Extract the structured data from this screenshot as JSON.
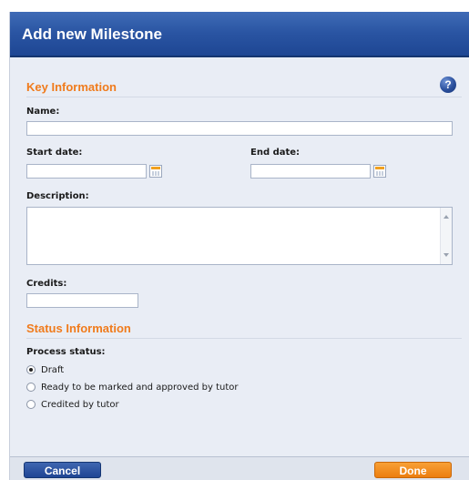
{
  "dialog": {
    "title": "Add new Milestone"
  },
  "key_information": {
    "heading": "Key Information",
    "help_icon": "?",
    "name_label": "Name:",
    "name_value": "",
    "start_date_label": "Start date:",
    "start_date_value": "",
    "end_date_label": "End date:",
    "end_date_value": "",
    "description_label": "Description:",
    "description_value": "",
    "credits_label": "Credits:",
    "credits_value": ""
  },
  "status_information": {
    "heading": "Status Information",
    "process_status_label": "Process status:",
    "options": [
      {
        "label": "Draft",
        "checked": true
      },
      {
        "label": "Ready to be marked and approved by tutor",
        "checked": false
      },
      {
        "label": "Credited by tutor",
        "checked": false
      }
    ]
  },
  "footer": {
    "cancel_label": "Cancel",
    "done_label": "Done"
  },
  "colors": {
    "title_bar": "#2a55a3",
    "section_heading": "#f07b1c",
    "done_button": "#ec7e10",
    "cancel_button": "#1f4594",
    "panel_background": "#e9edf5"
  },
  "icons": {
    "help": "question-circle-icon",
    "calendar": "calendar-icon"
  }
}
